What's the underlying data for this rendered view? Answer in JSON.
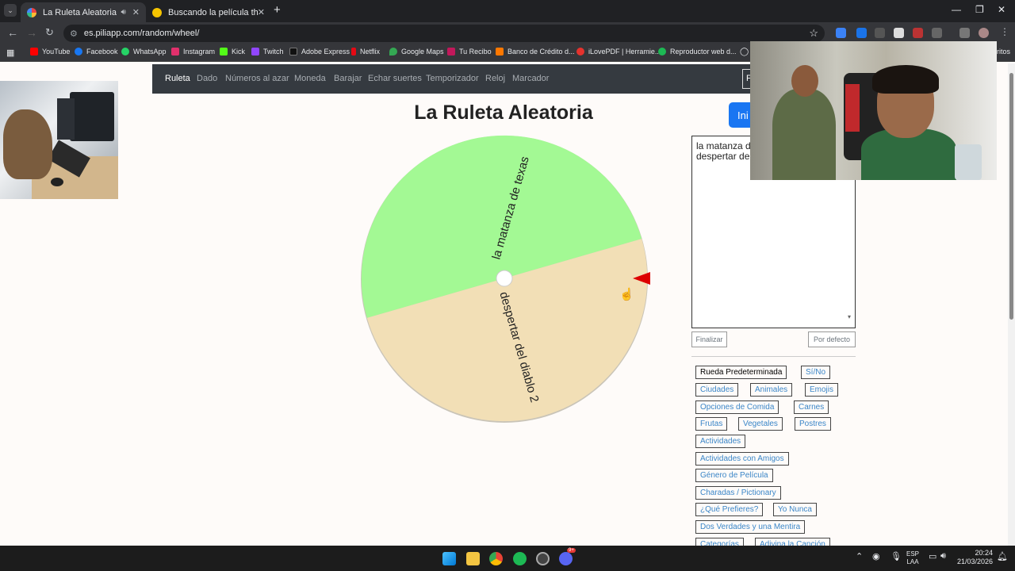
{
  "browser": {
    "tabs": [
      {
        "title": "La Ruleta Aleatoria",
        "active": true
      },
      {
        "title": "Buscando la película the goat -",
        "active": false
      }
    ],
    "url": "es.piliapp.com/random/wheel/",
    "bookmarks": [
      "YouTube",
      "Facebook",
      "WhatsApp",
      "Instagram",
      "Kick",
      "Twitch",
      "Adobe Express",
      "Netflix",
      "Google Maps",
      "Tu Recibo",
      "Banco de Crédito d...",
      "iLovePDF | Herramie...",
      "Reproductor web d...",
      "ritos"
    ]
  },
  "site_nav": {
    "items": [
      "Ruleta",
      "Dado",
      "Números al azar",
      "Moneda",
      "Barajar",
      "Echar suertes",
      "Temporizador",
      "Reloj",
      "Marcador"
    ],
    "active": "Ruleta",
    "partial_button": "F"
  },
  "page": {
    "title": "La Ruleta Aleatoria",
    "start_button": "Ini"
  },
  "wheel": {
    "segments": [
      {
        "label": "la matanza de texas",
        "color": "#a3f994"
      },
      {
        "label": "despertar del diablo 2",
        "color": "#f2dfb6"
      }
    ],
    "pointer_color": "#dd0000"
  },
  "editor": {
    "text": "la matanza d\ndespertar de",
    "finish_button": "Finalizar",
    "default_button": "Por defecto"
  },
  "presets": [
    "Rueda Predeterminada",
    "Sí/No",
    "Ciudades",
    "Animales",
    "Emojis",
    "Opciones de Comida",
    "Carnes",
    "Frutas",
    "Vegetales",
    "Postres",
    "Actividades",
    "Actividades con Amigos",
    "Género de Película",
    "Charadas / Pictionary",
    "¿Qué Prefieres?",
    "Yo Nunca",
    "Dos Verdades y una Mentira",
    "Categorías",
    "Adivina la Canción"
  ],
  "taskbar": {
    "lang": "ESP",
    "lang_sub": "LAA",
    "time": "20:24",
    "date": "21/03/2026",
    "discord_badge": "9+"
  }
}
